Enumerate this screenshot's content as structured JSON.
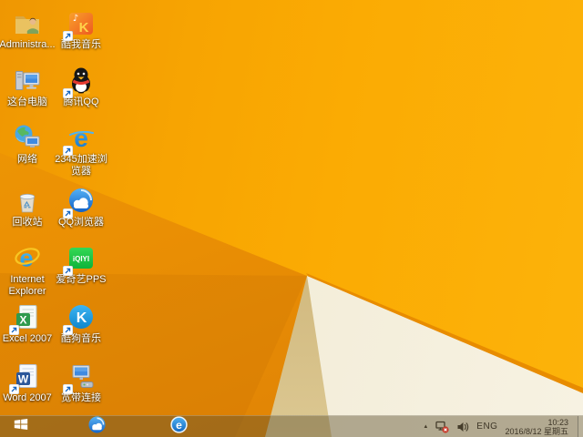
{
  "wallpaper": {
    "base_color": "#f7a402",
    "dark_left_color": "#e68a04",
    "tan_facet_color": "#cfb67b",
    "cream_facet_color": "#f2ecd7",
    "ridge_color": "#e88c00"
  },
  "desktop": {
    "col1": [
      {
        "label": "Administra...",
        "icon": "user-folder-icon",
        "shortcut": false
      },
      {
        "label": "这台电脑",
        "icon": "this-pc-icon",
        "shortcut": false
      },
      {
        "label": "网络",
        "icon": "network-icon",
        "shortcut": false
      },
      {
        "label": "回收站",
        "icon": "recycle-bin-icon",
        "shortcut": false
      },
      {
        "label": "Internet Explorer",
        "icon": "internet-explorer-icon",
        "shortcut": false
      },
      {
        "label": "Excel 2007",
        "icon": "excel-icon",
        "shortcut": true
      },
      {
        "label": "Word 2007",
        "icon": "word-icon",
        "shortcut": true
      }
    ],
    "col2": [
      {
        "label": "酷我音乐",
        "icon": "kuwo-music-icon",
        "shortcut": true
      },
      {
        "label": "腾讯QQ",
        "icon": "tencent-qq-icon",
        "shortcut": true
      },
      {
        "label": "2345加速浏览器",
        "icon": "2345-browser-icon",
        "shortcut": true
      },
      {
        "label": "QQ浏览器",
        "icon": "qq-browser-icon",
        "shortcut": true
      },
      {
        "label": "爱奇艺PPS",
        "icon": "iqiyi-pps-icon",
        "shortcut": true
      },
      {
        "label": "酷狗音乐",
        "icon": "kugou-music-icon",
        "shortcut": true
      },
      {
        "label": "宽带连接",
        "icon": "broadband-icon",
        "shortcut": true
      }
    ]
  },
  "taskbar": {
    "start_icon": "windows-start-icon",
    "pinned_icons": [
      "qq-browser-taskbar-icon",
      "e-browser-taskbar-icon"
    ],
    "tray": {
      "expand_glyph": "▲",
      "expand_icon": "chevron-up-icon",
      "network_icon": "network-disconnected-icon",
      "volume_icon": "speaker-icon",
      "language": "ENG",
      "time": "10:23",
      "date": "2016/8/12 星期五"
    }
  }
}
